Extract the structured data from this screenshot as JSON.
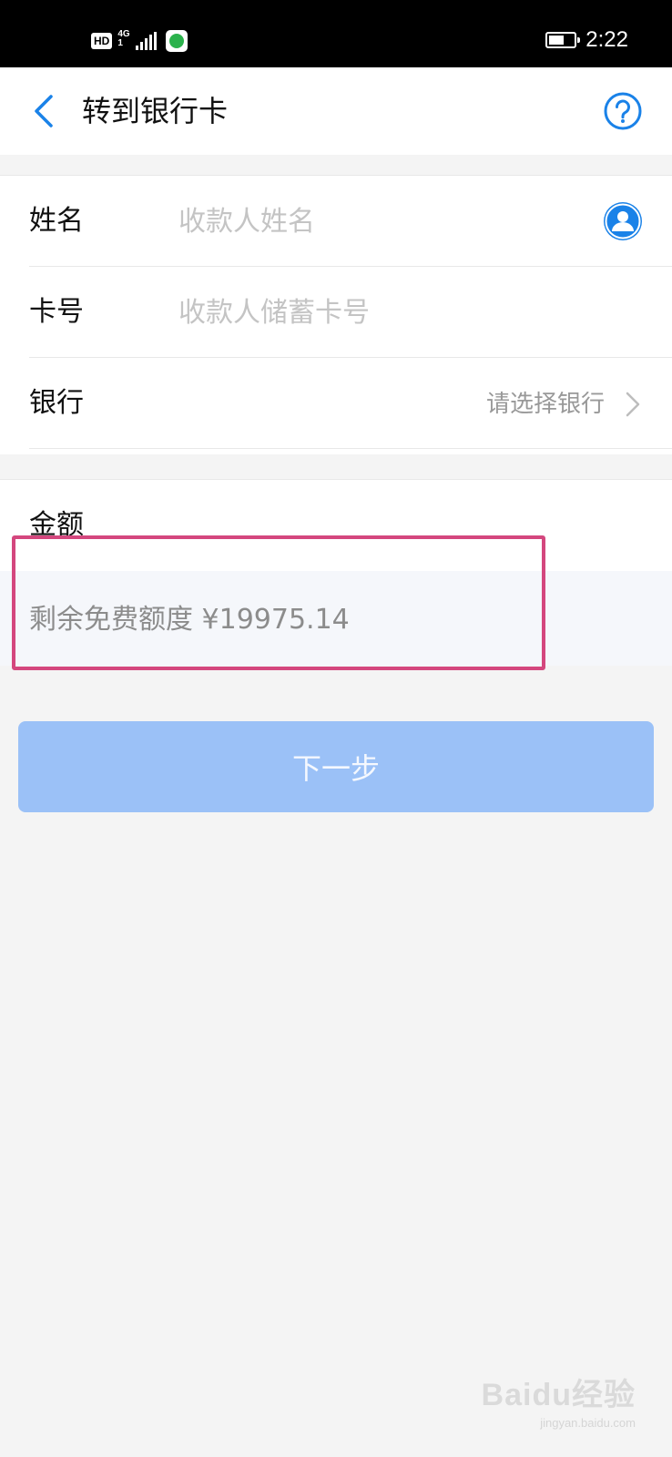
{
  "status_bar": {
    "hd": "HD",
    "network": "4G",
    "network_sub": "1",
    "time": "2:22",
    "battery_level": 0.6
  },
  "nav": {
    "title": "转到银行卡",
    "back_icon": "chevron-left-icon",
    "help_icon": "question-circle-icon"
  },
  "form": {
    "name": {
      "label": "姓名",
      "placeholder": "收款人姓名",
      "value": ""
    },
    "card": {
      "label": "卡号",
      "placeholder": "收款人储蓄卡号",
      "value": ""
    },
    "bank": {
      "label": "银行",
      "select_text": "请选择银行"
    }
  },
  "amount": {
    "label": "金额",
    "quota_text": "剩余免费额度 ¥19975.14"
  },
  "next_button": {
    "label": "下一步"
  },
  "watermark": {
    "logo": "Baidu经验",
    "url": "jingyan.baidu.com"
  },
  "colors": {
    "accent": "#1a82e8",
    "button_disabled": "#9bc1f7",
    "highlight": "#d4477e"
  }
}
